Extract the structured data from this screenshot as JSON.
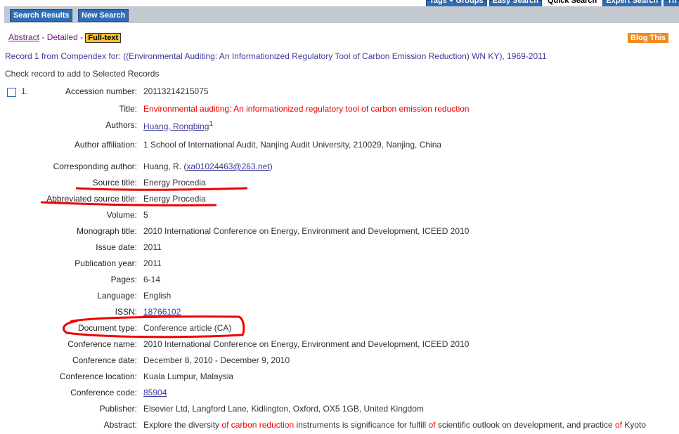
{
  "tabs": [
    "Tags + Groups",
    "Easy Search",
    "Quick Search",
    "Expert Search",
    "Th"
  ],
  "buttons": {
    "search_results": "Search Results",
    "new_search": "New Search"
  },
  "views": {
    "abstract": "Abstract",
    "sep": "-",
    "detailed": "Detailed",
    "fulltext": "Full-text"
  },
  "blog_this": "Blog This",
  "record_line": "Record 1 from Compendex for: ((Environmental Auditing: An Informationized Regulatory Tool of Carbon Emission Reduction) WN KY), 1969-2011",
  "check_text": "Check record to add to Selected Records",
  "record_number": "1.",
  "fields": [
    {
      "label": "Accession number:",
      "value": "20113214215075"
    },
    {
      "label": "Title:",
      "value": "Environmental auditing: An informationized regulatory tool of carbon emission reduction",
      "style": "red"
    },
    {
      "label": "Authors:",
      "value": "Huang, Rongbing",
      "link": true,
      "sup": "1"
    },
    {
      "label": "Author affiliation:",
      "value": " 1 School of International Audit, Nanjing Audit University, 210029, Nanjing, China"
    },
    {
      "label": "Corresponding author:",
      "value": "Huang, R. (",
      "email": "xa01024463@263.net",
      "after": ")"
    },
    {
      "label": "Source title:",
      "value": "Energy Procedia"
    },
    {
      "label": "Abbreviated source title:",
      "value": "Energy Procedia"
    },
    {
      "label": "Volume:",
      "value": "5"
    },
    {
      "label": "Monograph title:",
      "value": "2010 International Conference on Energy, Environment and Development, ICEED 2010"
    },
    {
      "label": "Issue date:",
      "value": "2011"
    },
    {
      "label": "Publication year:",
      "value": "2011"
    },
    {
      "label": "Pages:",
      "value": "6-14"
    },
    {
      "label": "Language:",
      "value": "English"
    },
    {
      "label": "ISSN:",
      "value": "18766102",
      "link": true
    },
    {
      "label": "Document type:",
      "value": "Conference article (CA)"
    },
    {
      "label": "Conference name:",
      "value": "2010 International Conference on Energy, Environment and Development, ICEED 2010"
    },
    {
      "label": "Conference date:",
      "value": "December 8, 2010 - December 9, 2010"
    },
    {
      "label": "Conference location:",
      "value": "Kuala Lumpur, Malaysia"
    },
    {
      "label": "Conference code:",
      "value": "85904",
      "link": true
    },
    {
      "label": "Publisher:",
      "value": "Elsevier Ltd, Langford Lane, Kidlington, Oxford, OX5 1GB, United Kingdom"
    }
  ],
  "abstract": {
    "label": "Abstract:",
    "segments": [
      {
        "t": "Explore the diversity ",
        "h": false
      },
      {
        "t": "of carbon reduction",
        "h": true
      },
      {
        "t": " instruments is significance for fulfill ",
        "h": false
      },
      {
        "t": "of",
        "h": true
      },
      {
        "t": " scientific outlook on development, and practice ",
        "h": false
      },
      {
        "t": "of",
        "h": true
      },
      {
        "t": " Kyoto",
        "h": false
      }
    ]
  },
  "colors": {
    "annotation": "#e00000",
    "button_blue": "#2f6db5",
    "highlight": "#f8c232"
  }
}
